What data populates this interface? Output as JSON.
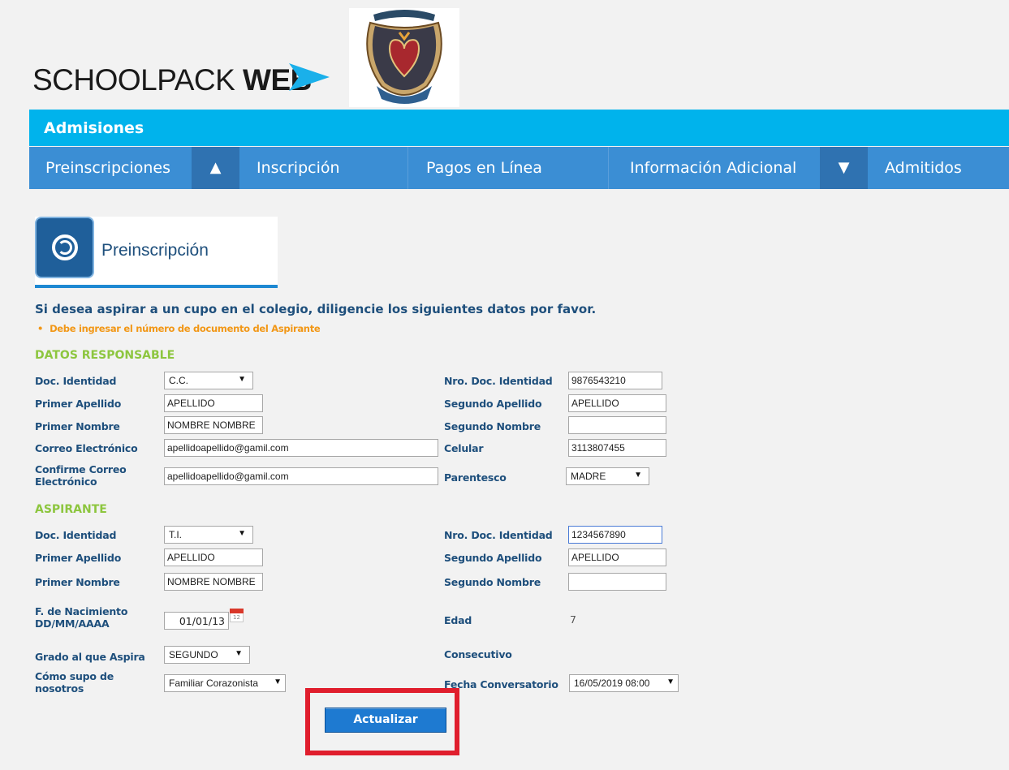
{
  "header": {
    "logo_text_light": "SCHOOLPACK ",
    "logo_text_bold": "WEB"
  },
  "module": {
    "title": "Admisiones"
  },
  "nav": {
    "items": [
      "Preinscripciones",
      "Inscripción",
      "Pagos en Línea",
      "Información Adicional",
      "Admitidos"
    ],
    "toggle_up": "▲",
    "toggle_down": "▼"
  },
  "page": {
    "title": "Preinscripción",
    "intro": "Si desea aspirar a un cupo en el colegio, diligencie los siguientes datos por favor.",
    "warning": "Debe ingresar el número de documento del Aspirante"
  },
  "responsable": {
    "section_title": "DATOS RESPONSABLE",
    "labels": {
      "doc_identidad": "Doc. Identidad",
      "primer_apellido": "Primer Apellido",
      "primer_nombre": "Primer Nombre",
      "correo": "Correo Electrónico",
      "confirme_correo_1": "Confirme Correo",
      "confirme_correo_2": "Electrónico",
      "nro_doc": "Nro. Doc. Identidad",
      "segundo_apellido": "Segundo Apellido",
      "segundo_nombre": "Segundo Nombre",
      "celular": "Celular",
      "parentesco": "Parentesco"
    },
    "values": {
      "doc_identidad": "C.C.",
      "primer_apellido": "APELLIDO",
      "primer_nombre": "NOMBRE NOMBRE",
      "correo": "apellidoapellido@gamil.com",
      "confirme_correo": "apellidoapellido@gamil.com",
      "nro_doc": "9876543210",
      "segundo_apellido": "APELLIDO",
      "segundo_nombre": "",
      "celular": "3113807455",
      "parentesco": "MADRE"
    }
  },
  "aspirante": {
    "section_title": "ASPIRANTE",
    "labels": {
      "doc_identidad": "Doc. Identidad",
      "primer_apellido": "Primer Apellido",
      "primer_nombre": "Primer Nombre",
      "nacimiento_1": "F. de Nacimiento",
      "nacimiento_2": "DD/MM/AAAA",
      "grado": "Grado al que Aspira",
      "como_supo_1": "Cómo supo de",
      "como_supo_2": "nosotros",
      "nro_doc": "Nro. Doc. Identidad",
      "segundo_apellido": "Segundo Apellido",
      "segundo_nombre": "Segundo Nombre",
      "edad": "Edad",
      "consecutivo": "Consecutivo",
      "fecha_conversatorio": "Fecha Conversatorio"
    },
    "values": {
      "doc_identidad": "T.I.",
      "primer_apellido": "APELLIDO",
      "primer_nombre": "NOMBRE NOMBRE",
      "nacimiento": "01/01/13",
      "grado": "SEGUNDO",
      "como_supo": "Familiar Corazonista",
      "nro_doc": "1234567890",
      "segundo_apellido": "APELLIDO",
      "segundo_nombre": "",
      "edad": "7",
      "consecutivo": "",
      "fecha_conversatorio": "16/05/2019 08:00"
    }
  },
  "actions": {
    "submit_label": "Actualizar"
  },
  "icons": {
    "caret": "▼"
  },
  "colors": {
    "module_bar": "#00b3ec",
    "nav_bar": "#3b8ed4",
    "label_text": "#1e4f7c",
    "section_title": "#8dc63f",
    "warning": "#f29716",
    "button": "#1e7ad1",
    "highlight": "#e01e2d"
  }
}
